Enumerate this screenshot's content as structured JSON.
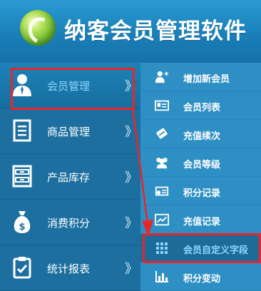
{
  "app": {
    "title": "纳客会员管理软件"
  },
  "sidebar": {
    "items": [
      {
        "label": "会员管理",
        "icon": "user-icon",
        "active": true
      },
      {
        "label": "商品管理",
        "icon": "document-icon",
        "active": false
      },
      {
        "label": "产品库存",
        "icon": "cabinet-icon",
        "active": false
      },
      {
        "label": "消费积分",
        "icon": "money-bag-icon",
        "active": false
      },
      {
        "label": "统计报表",
        "icon": "clipboard-check-icon",
        "active": false
      }
    ],
    "chevron": "》"
  },
  "submenu": {
    "items": [
      {
        "label": "增加新会员",
        "icon": "add-user-icon"
      },
      {
        "label": "会员列表",
        "icon": "id-card-icon"
      },
      {
        "label": "充值续次",
        "icon": "card-icon"
      },
      {
        "label": "会员等级",
        "icon": "user-group-icon"
      },
      {
        "label": "积分记录",
        "icon": "coins-icon"
      },
      {
        "label": "充值记录",
        "icon": "line-chart-icon"
      },
      {
        "label": "会员自定义字段",
        "icon": "grid-icon",
        "selected": true
      },
      {
        "label": "积分变动",
        "icon": "bar-chart-icon"
      }
    ]
  },
  "colors": {
    "header": "#1a7fb8",
    "sidebar": "#1c6f9f",
    "submenu": "#2d8fc4",
    "highlight": "#e8262a"
  }
}
